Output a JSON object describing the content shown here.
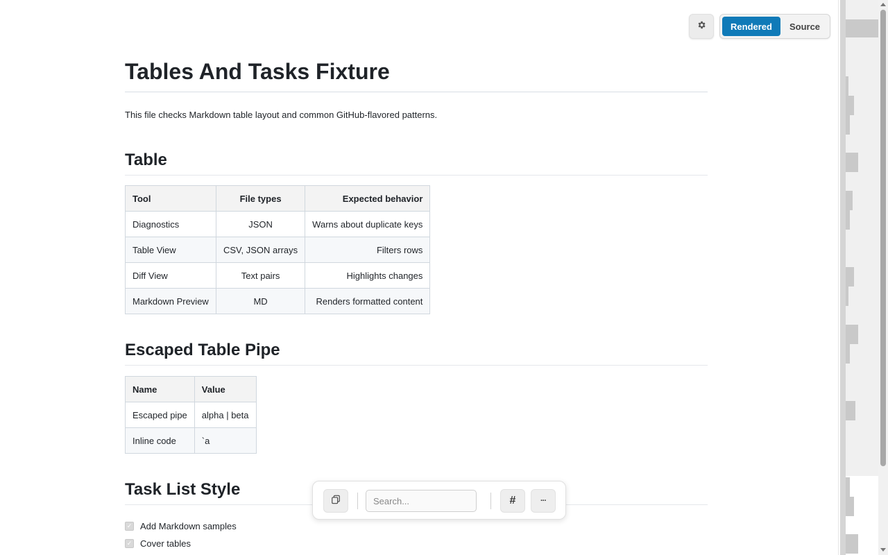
{
  "controls": {
    "settings_icon": "gear-icon",
    "view_rendered": "Rendered",
    "view_source": "Source"
  },
  "doc": {
    "title": "Tables And Tasks Fixture",
    "intro": "This file checks Markdown table layout and common GitHub-flavored patterns.",
    "sections": {
      "table": {
        "heading": "Table",
        "columns": [
          "Tool",
          "File types",
          "Expected behavior"
        ],
        "rows": [
          [
            "Diagnostics",
            "JSON",
            "Warns about duplicate keys"
          ],
          [
            "Table View",
            "CSV, JSON arrays",
            "Filters rows"
          ],
          [
            "Diff View",
            "Text pairs",
            "Highlights changes"
          ],
          [
            "Markdown Preview",
            "MD",
            "Renders formatted content"
          ]
        ]
      },
      "escaped": {
        "heading": "Escaped Table Pipe",
        "columns": [
          "Name",
          "Value"
        ],
        "rows": [
          [
            "Escaped pipe",
            "alpha | beta"
          ],
          [
            "Inline code",
            "`a"
          ]
        ]
      },
      "tasks": {
        "heading": "Task List Style",
        "items": [
          {
            "label": "Add Markdown samples",
            "checked": true
          },
          {
            "label": "Cover tables",
            "checked": true
          }
        ]
      }
    }
  },
  "toolbar": {
    "copy_icon": "copy-icon",
    "search_placeholder": "Search...",
    "heading_button": "#",
    "more_button": "···"
  }
}
